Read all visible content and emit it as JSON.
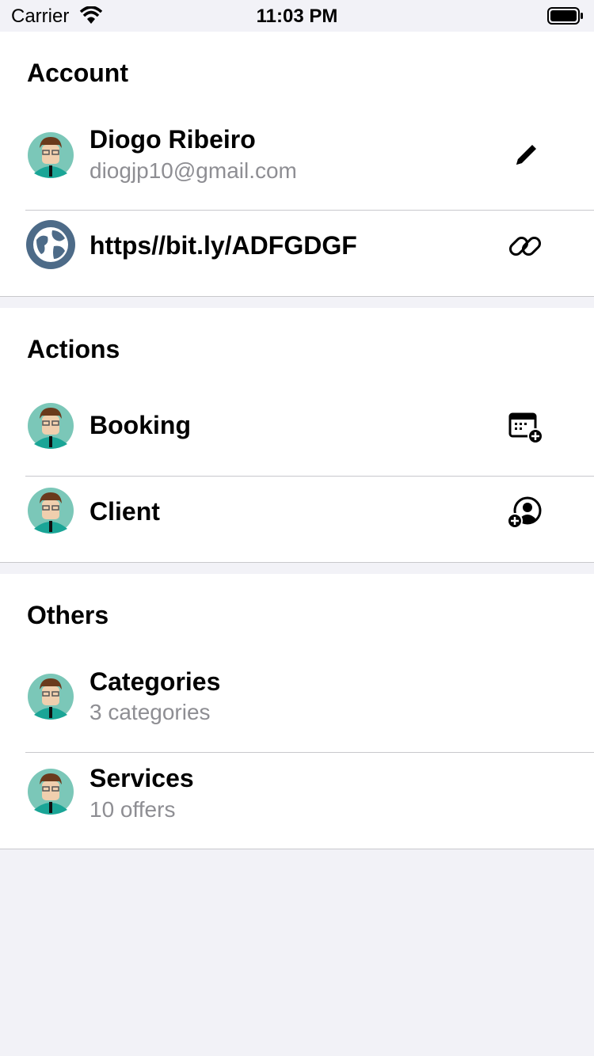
{
  "status_bar": {
    "carrier": "Carrier",
    "time": "11:03 PM"
  },
  "sections": [
    {
      "title": "Account",
      "rows": [
        {
          "title": "Diogo Ribeiro",
          "subtitle": "diogjp10@gmail.com",
          "icon": "avatar-icon",
          "accessory": "pencil-icon"
        },
        {
          "title": "https//bit.ly/ADFGDGF",
          "icon": "globe-icon",
          "accessory": "link-icon"
        }
      ]
    },
    {
      "title": "Actions",
      "rows": [
        {
          "title": "Booking",
          "icon": "avatar-icon",
          "accessory": "calendar-add-icon"
        },
        {
          "title": "Client",
          "icon": "avatar-icon",
          "accessory": "person-add-icon"
        }
      ]
    },
    {
      "title": "Others",
      "rows": [
        {
          "title": "Categories",
          "subtitle": "3 categories",
          "icon": "avatar-icon"
        },
        {
          "title": "Services",
          "subtitle": "10 offers",
          "icon": "avatar-icon"
        }
      ]
    }
  ],
  "colors": {
    "background": "#f2f2f7",
    "separator": "#c8c8cc",
    "secondary_text": "#8e8e93"
  }
}
